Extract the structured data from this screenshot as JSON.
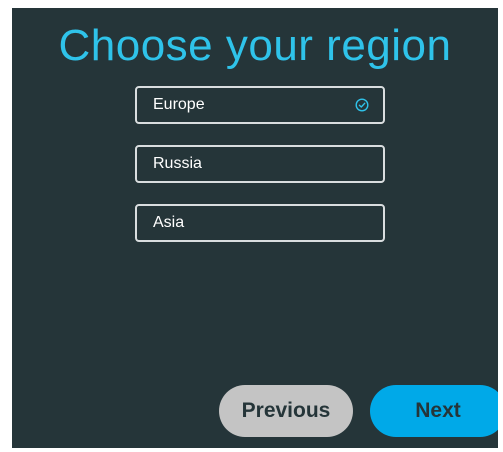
{
  "screen": {
    "title": "Choose your region",
    "background_color": "#253539",
    "accent_color": "#2fc3ea"
  },
  "regions": {
    "selected": "Europe",
    "options": [
      {
        "label": "Europe",
        "selected": true,
        "icon": "check-circle-icon"
      },
      {
        "label": "Russia",
        "selected": false
      },
      {
        "label": "Asia",
        "selected": false
      }
    ]
  },
  "navigation": {
    "previous_label": "Previous",
    "next_label": "Next",
    "previous_color": "#c4c4c4",
    "next_color": "#00a9e8"
  }
}
